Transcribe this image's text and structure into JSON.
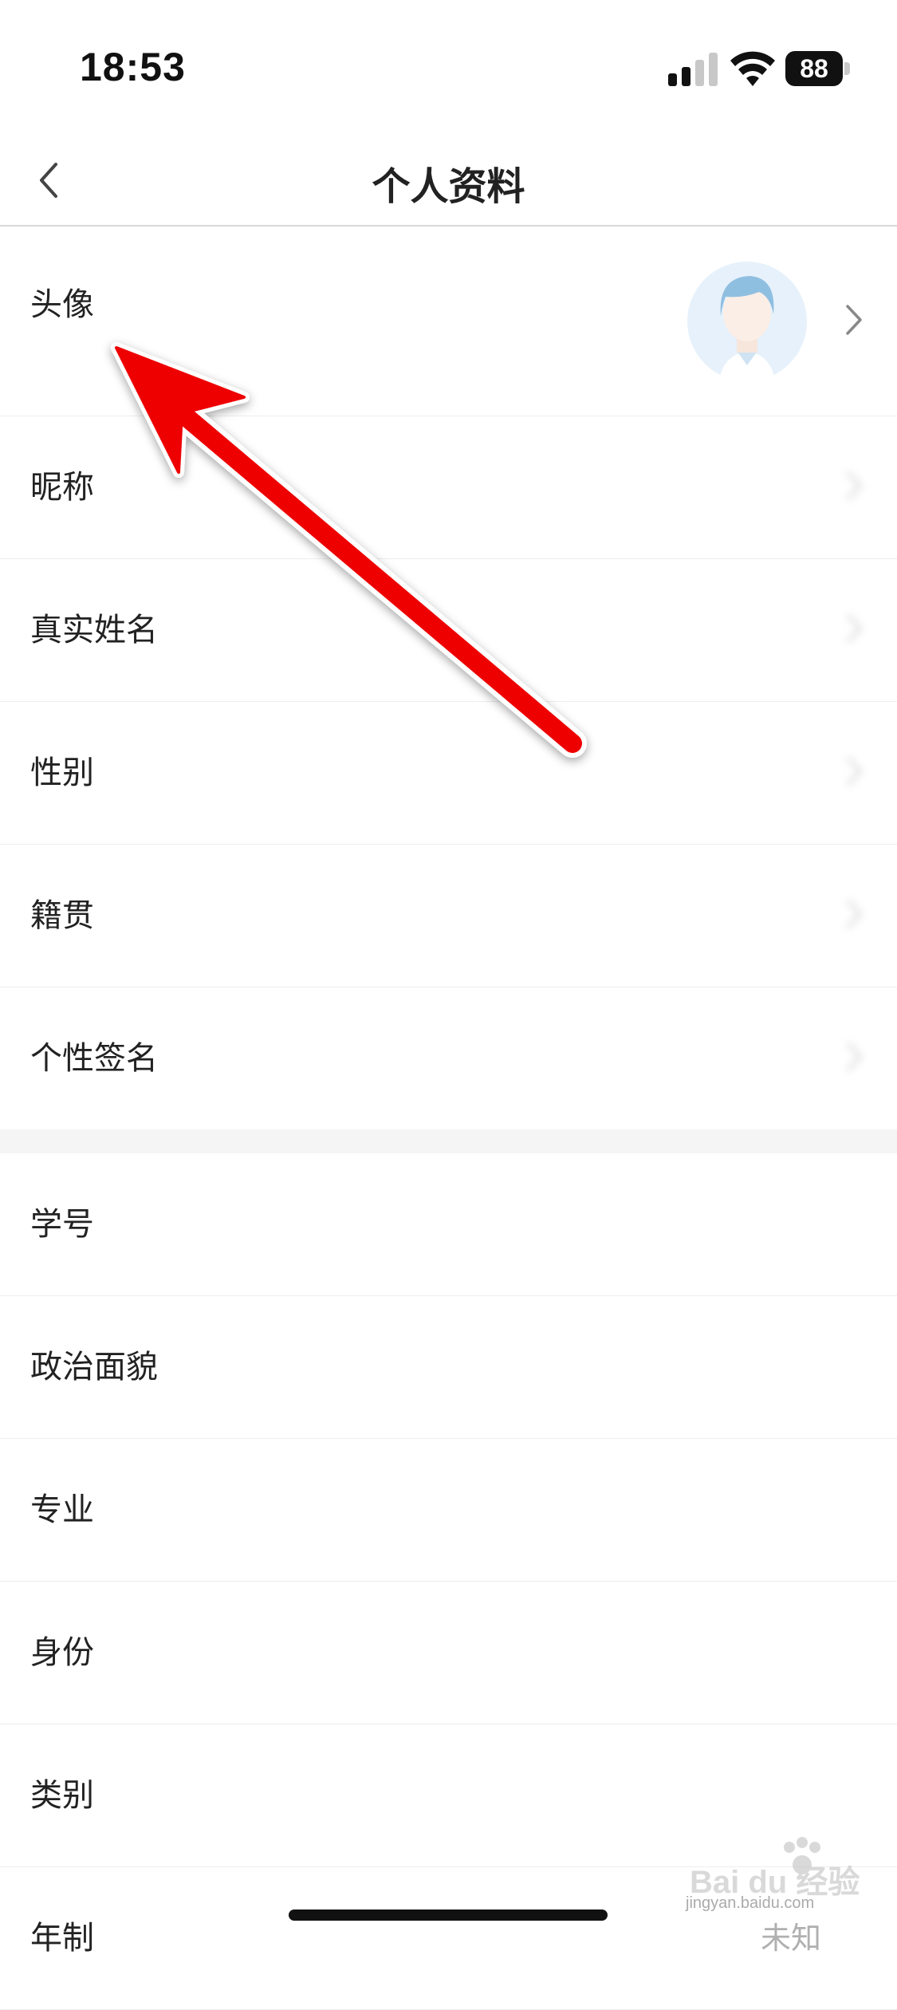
{
  "status_bar": {
    "time": "18:53",
    "battery": "88",
    "icons": [
      "signal-icon",
      "wifi-icon",
      "battery-icon"
    ]
  },
  "nav": {
    "title": "个人资料",
    "back_icon": "chevron-left-icon"
  },
  "rows": [
    {
      "label": "头像"
    },
    {
      "label": "昵称"
    },
    {
      "label": "真实姓名"
    },
    {
      "label": "性别"
    },
    {
      "label": "籍贯"
    },
    {
      "label": "个性签名"
    },
    {
      "label": "学号"
    },
    {
      "label": "政治面貌"
    },
    {
      "label": "专业"
    },
    {
      "label": "身份"
    },
    {
      "label": "类别"
    },
    {
      "label": "年制",
      "value": "未知"
    }
  ],
  "colors": {
    "arrow": "#ee0000",
    "avatar_bg": "#e6f1fb",
    "avatar_hair": "#8fbfe0"
  },
  "watermark": {
    "logo": "Bai du 经验",
    "url": "jingyan.baidu.com"
  }
}
